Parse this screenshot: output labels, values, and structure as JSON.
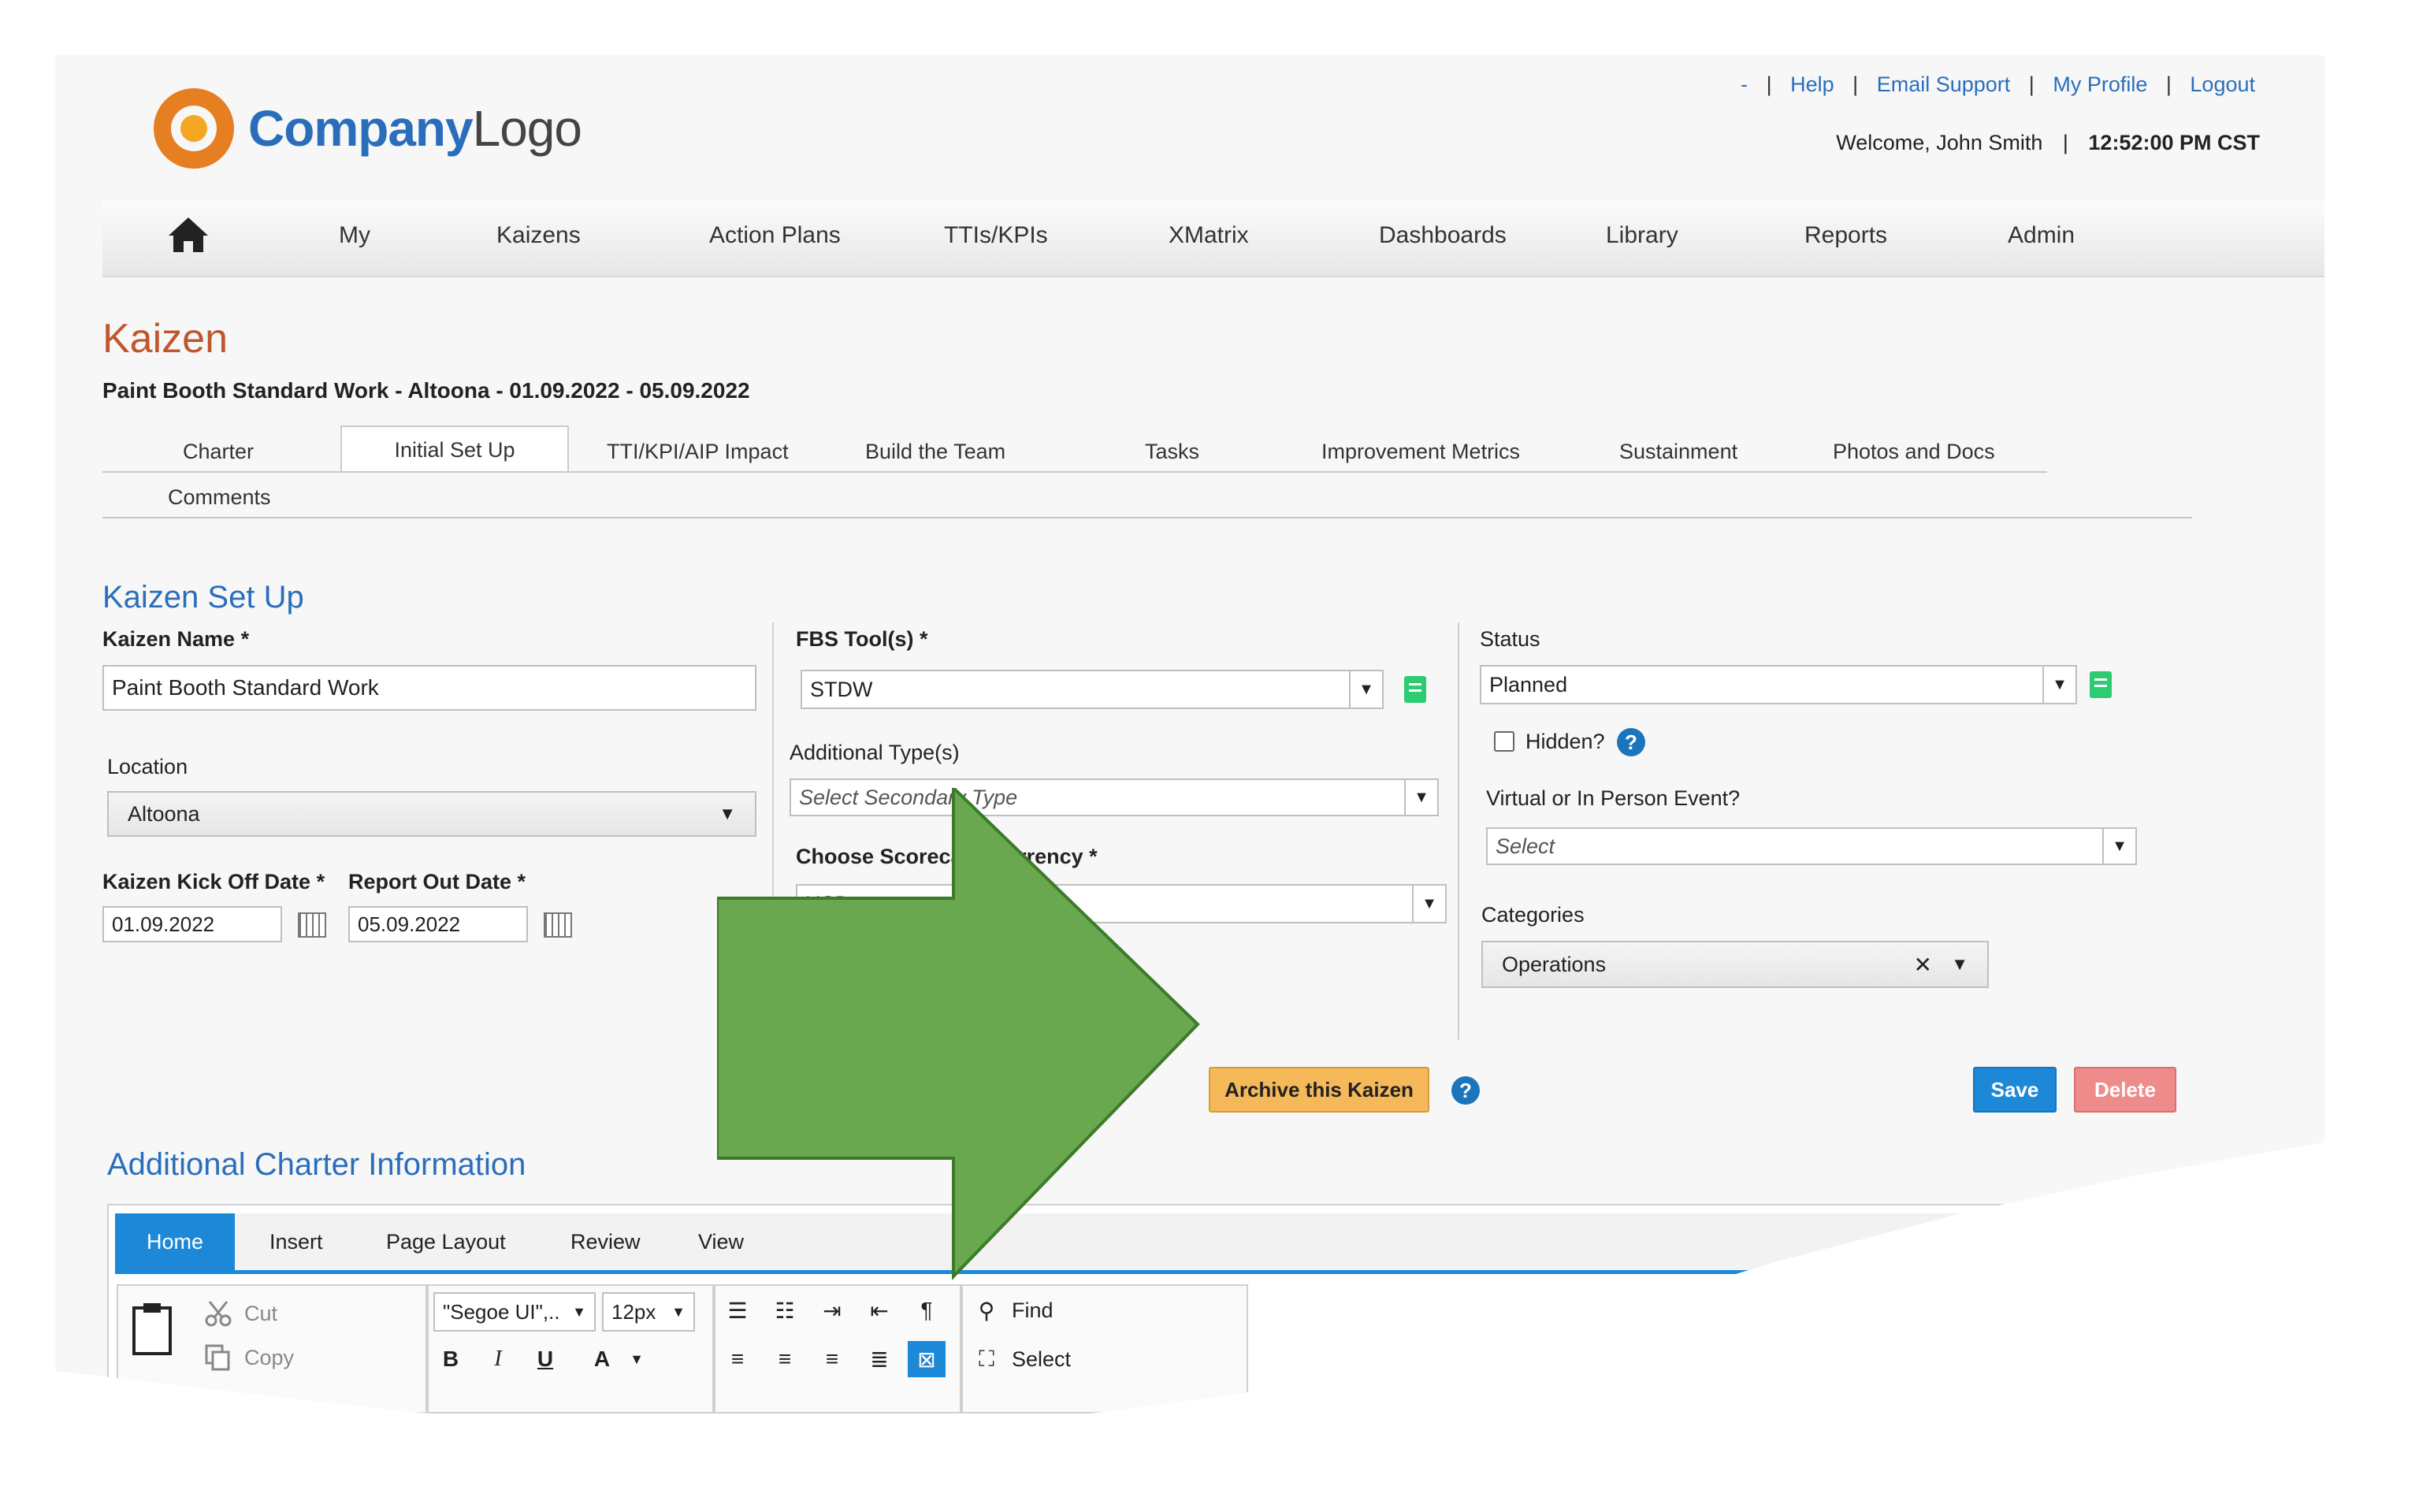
{
  "header": {
    "top_links": [
      "-",
      "Help",
      "Email Support",
      "My Profile",
      "Logout"
    ],
    "welcome": "Welcome, John Smith",
    "separator": "|",
    "time": "12:52:00 PM CST",
    "logo_company": "Company",
    "logo_logo": "Logo"
  },
  "nav": {
    "items": [
      "My",
      "Kaizens",
      "Action Plans",
      "TTIs/KPIs",
      "XMatrix",
      "Dashboards",
      "Library",
      "Reports",
      "Admin"
    ]
  },
  "page": {
    "title": "Kaizen",
    "subtitle": "Paint Booth Standard Work - Altoona - 01.09.2022 - 05.09.2022"
  },
  "tabs": [
    "Charter",
    "Initial Set Up",
    "TTI/KPI/AIP Impact",
    "Build the Team",
    "Tasks",
    "Improvement Metrics",
    "Sustainment",
    "Photos and Docs",
    "Comments"
  ],
  "setup": {
    "section_title": "Kaizen Set Up",
    "kaizen_name_label": "Kaizen Name *",
    "kaizen_name_value": "Paint Booth Standard Work",
    "location_label": "Location",
    "location_value": "Altoona",
    "kickoff_label": "Kaizen Kick Off Date *",
    "kickoff_value": "01.09.2022",
    "report_label": "Report Out Date *",
    "report_value": "05.09.2022",
    "fbs_label": "FBS Tool(s) *",
    "fbs_value": "STDW",
    "additional_label": "Additional Type(s)",
    "additional_placeholder": "Select Secondary Type",
    "currency_label": "Choose Scorecard Currency *",
    "currency_value": "USD",
    "status_label": "Status",
    "status_value": "Planned",
    "hidden_label": "Hidden?",
    "virtual_label": "Virtual or In Person Event?",
    "virtual_placeholder": "Select",
    "categories_label": "Categories",
    "categories_value": "Operations",
    "clear_symbol": "✕"
  },
  "buttons": {
    "archive": "Archive this Kaizen",
    "save": "Save",
    "delete": "Delete"
  },
  "charter": {
    "section_title": "Additional Charter Information"
  },
  "editor": {
    "tabs": [
      "Home",
      "Insert",
      "Page Layout",
      "Review",
      "View"
    ],
    "cut": "Cut",
    "copy": "Copy",
    "font": "\"Segoe UI\",..",
    "size": "12px",
    "bold": "B",
    "italic": "I",
    "underline": "U",
    "font_color": "A",
    "find": "Find",
    "select": "Select"
  },
  "colors": {
    "accent": "#1e88d8",
    "title": "#c0562b",
    "link": "#2a6ebb",
    "arrow": "#6aa84f",
    "archive": "#f5b95a",
    "delete": "#ee8b8b"
  }
}
